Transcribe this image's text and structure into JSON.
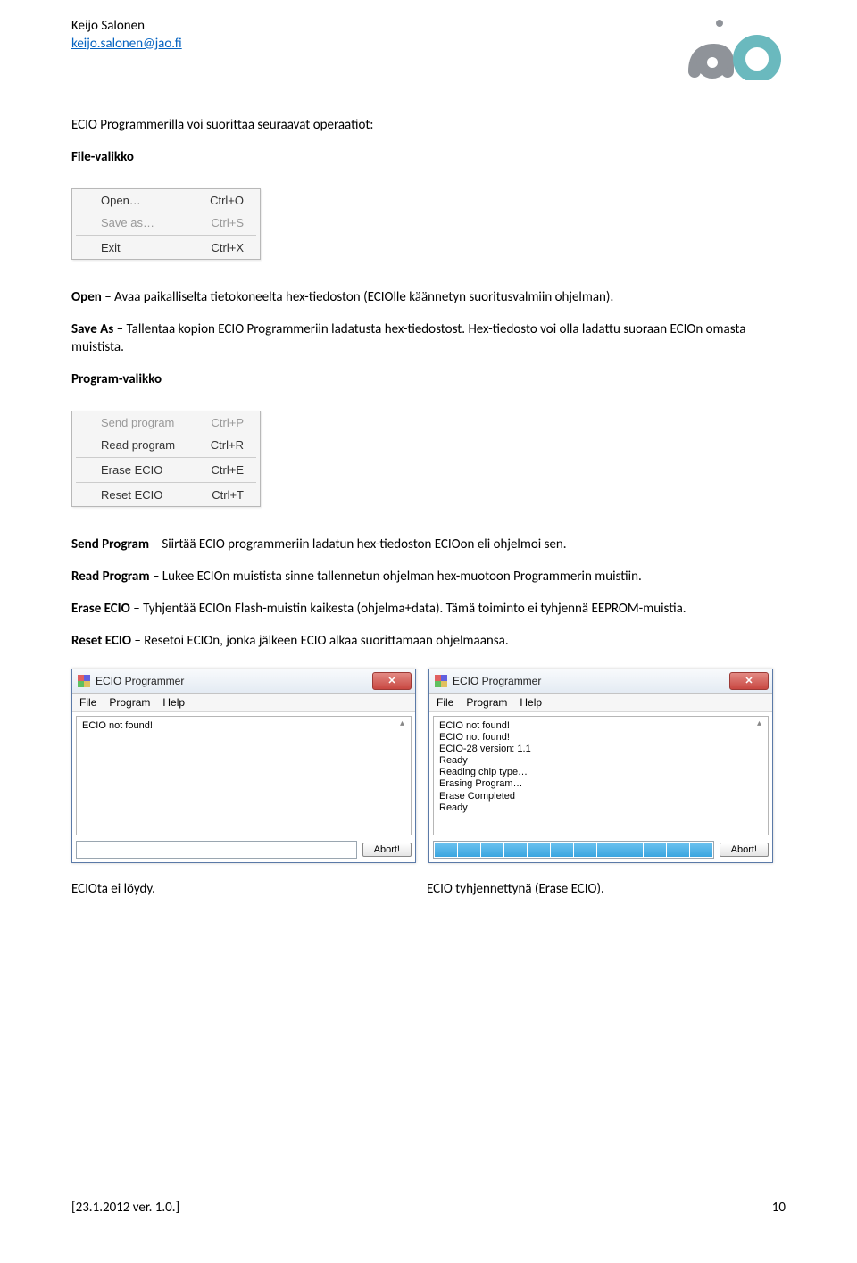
{
  "header": {
    "author": "Keijo Salonen",
    "email": "keijo.salonen@jao.fi"
  },
  "intro": "ECIO Programmerilla voi suorittaa seuraavat operaatiot:",
  "file_heading": "File-valikko",
  "file_menu": {
    "open": {
      "label": "Open…",
      "shortcut": "Ctrl+O"
    },
    "save_as": {
      "label": "Save as…",
      "shortcut": "Ctrl+S"
    },
    "exit": {
      "label": "Exit",
      "shortcut": "Ctrl+X"
    }
  },
  "open_desc_label": "Open",
  "open_desc_text": " – Avaa paikalliselta tietokoneelta hex-tiedoston (ECIOlle käännetyn suoritusvalmiin ohjelman).",
  "save_as_label": "Save As",
  "save_as_text": " – Tallentaa kopion ECIO Programmeriin ladatusta hex-tiedostost. Hex-tiedosto voi olla ladattu suoraan ECIOn omasta muistista.",
  "program_heading": "Program-valikko",
  "program_menu": {
    "send": {
      "label": "Send program",
      "shortcut": "Ctrl+P"
    },
    "read": {
      "label": "Read program",
      "shortcut": "Ctrl+R"
    },
    "erase": {
      "label": "Erase ECIO",
      "shortcut": "Ctrl+E"
    },
    "reset": {
      "label": "Reset ECIO",
      "shortcut": "Ctrl+T"
    }
  },
  "send_label": "Send Program",
  "send_text": " – Siirtää ECIO programmeriin ladatun hex-tiedoston ECIOon eli ohjelmoi sen.",
  "read_label": "Read Program",
  "read_text": " – Lukee ECIOn muistista sinne tallennetun ohjelman hex-muotoon Programmerin muistiin.",
  "erase_label": "Erase ECIO",
  "erase_text": " – Tyhjentää ECIOn Flash-muistin kaikesta (ohjelma+data). Tämä toiminto ei tyhjennä EEPROM-muistia.",
  "reset_label": "Reset ECIO",
  "reset_text": " – Resetoi ECIOn, jonka jälkeen ECIO alkaa suorittamaan ohjelmaansa.",
  "window": {
    "title": "ECIO Programmer",
    "menus": {
      "file": "File",
      "program": "Program",
      "help": "Help"
    },
    "abort": "Abort!"
  },
  "left_status": {
    "lines": [
      "ECIO not found!"
    ]
  },
  "right_status": {
    "lines": [
      "ECIO not found!",
      "ECIO not found!",
      "ECIO-28 version: 1.1",
      "Ready",
      "Reading chip type…",
      "Erasing Program…",
      "Erase Completed",
      "Ready"
    ]
  },
  "left_caption": "ECIOta ei löydy.",
  "right_caption": "ECIO tyhjennettynä (Erase ECIO).",
  "footer": {
    "version": "[23.1.2012 ver. 1.0.]",
    "page": "10"
  }
}
